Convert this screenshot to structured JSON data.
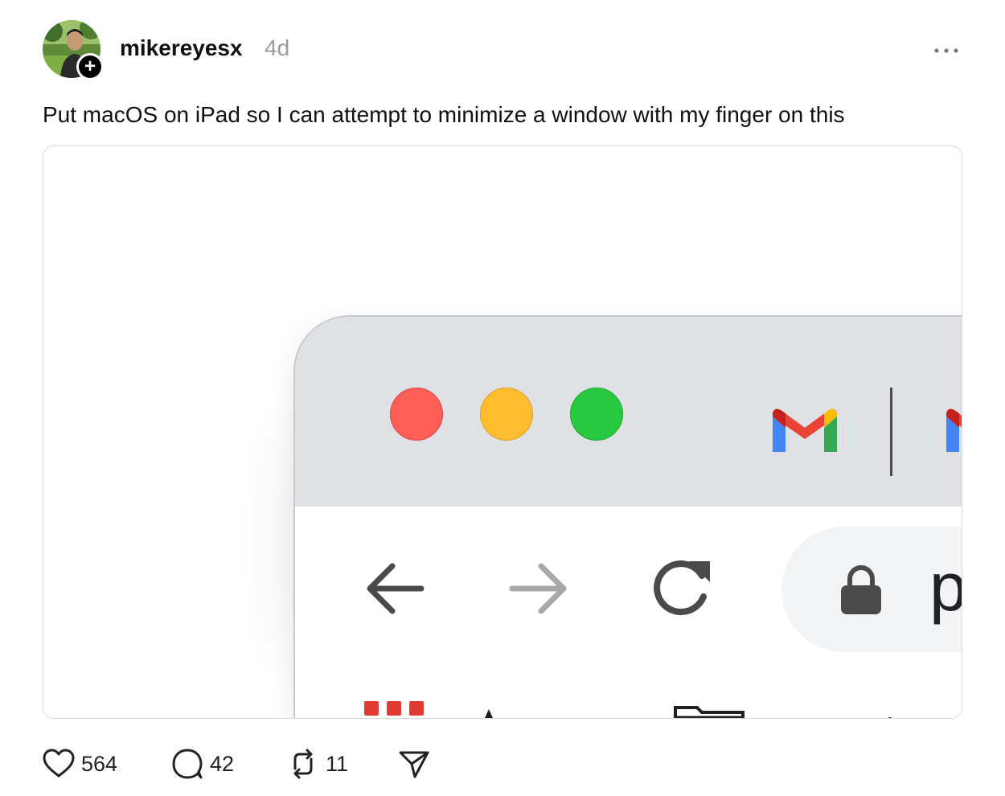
{
  "post": {
    "username": "mikereyesx",
    "timestamp": "4d",
    "text": "Put macOS on iPad so I can attempt to minimize a window with my finger on this"
  },
  "icons": {
    "avatar": "profile-photo",
    "follow": "plus-icon",
    "more": "ellipsis-icon",
    "like": "heart-icon",
    "reply": "speech-bubble-icon",
    "repost": "repost-icon",
    "share": "paper-plane-icon"
  },
  "media": {
    "browser": {
      "url_fragment": "p",
      "traffic_lights": {
        "close": "#fe5f57",
        "minimize": "#febc2e",
        "zoom": "#28c840"
      },
      "titlebar_color": "#dfe1e5"
    }
  },
  "actions": {
    "likes": "564",
    "replies": "42",
    "reposts": "11"
  }
}
